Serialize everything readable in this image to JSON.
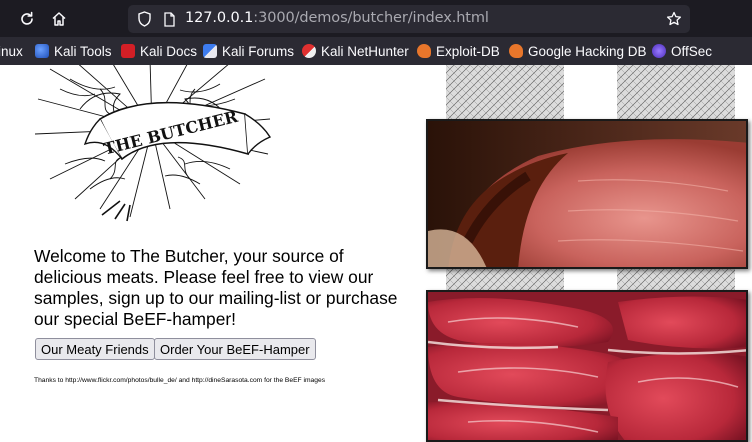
{
  "browser": {
    "url_host": "127.0.0.1",
    "url_rest": ":3000/demos/butcher/index.html",
    "bookmarks": [
      {
        "label": "inux",
        "icon": "kali-linux-icon"
      },
      {
        "label": "Kali Tools",
        "icon": "kali-tools-icon"
      },
      {
        "label": "Kali Docs",
        "icon": "kali-docs-icon"
      },
      {
        "label": "Kali Forums",
        "icon": "kali-forums-icon"
      },
      {
        "label": "Kali NetHunter",
        "icon": "kali-nethunter-icon"
      },
      {
        "label": "Exploit-DB",
        "icon": "exploit-db-icon"
      },
      {
        "label": "Google Hacking DB",
        "icon": "google-hacking-db-icon"
      },
      {
        "label": "OffSec",
        "icon": "offsec-icon"
      }
    ]
  },
  "page": {
    "logo_text": "THE BUTCHER",
    "welcome_text": "Welcome to The Butcher, your source of delicious meats. Please feel free to view our samples, sign up to our mailing-list or purchase our special BeEF-hamper!",
    "buttons": {
      "meaty_friends": "Our Meaty Friends",
      "order_hamper": "Order Your BeEF-Hamper"
    },
    "thanks_text": "Thanks to http://www.flickr.com/photos/bulle_de/ and http://dineSarasota.com for the BeEF images"
  }
}
